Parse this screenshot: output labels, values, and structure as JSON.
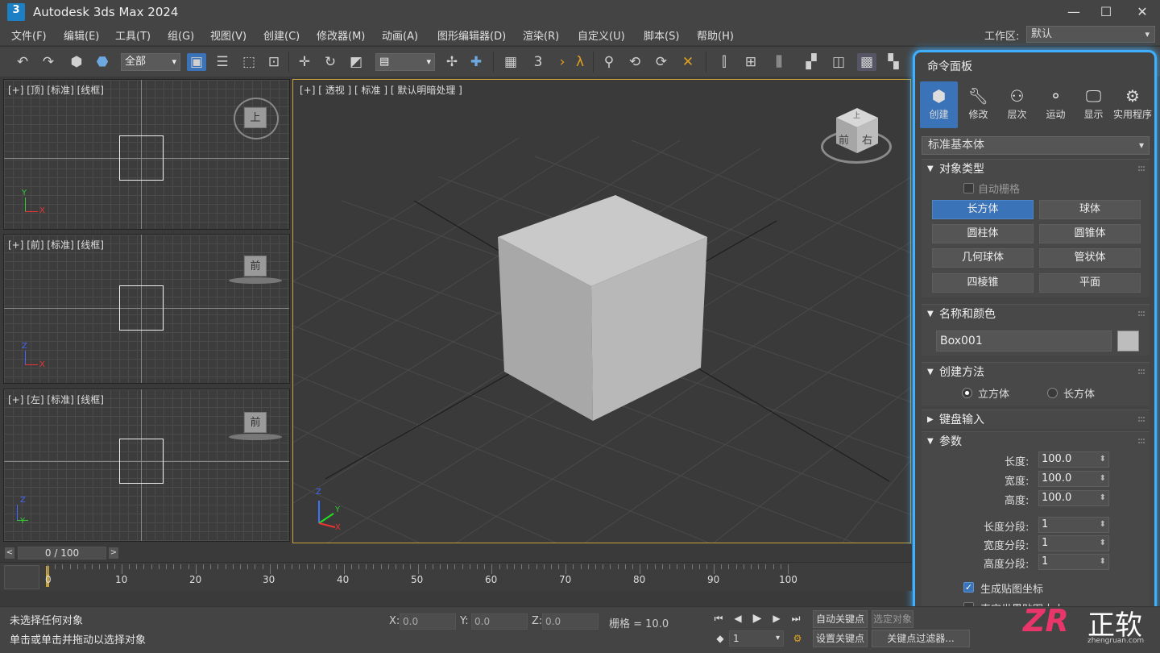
{
  "window": {
    "title": "Autodesk 3ds Max 2024",
    "app_icon": "3",
    "minimize": "—",
    "maximize": "☐",
    "close": "✕"
  },
  "menu": {
    "items": [
      "文件(F)",
      "编辑(E)",
      "工具(T)",
      "组(G)",
      "视图(V)",
      "创建(C)",
      "修改器(M)",
      "动画(A)",
      "图形编辑器(D)",
      "渲染(R)",
      "自定义(U)",
      "脚本(S)",
      "帮助(H)"
    ],
    "workspace_label": "工作区:",
    "workspace_value": "默认"
  },
  "toolbar": {
    "selection_filter": "全部",
    "icons": [
      "undo-icon",
      "redo-icon",
      "link-icon",
      "unlink-icon",
      "select-object-icon",
      "select-by-name-icon",
      "rect-select-icon",
      "window-crossing-icon",
      "move-icon",
      "rotate-icon",
      "scale-icon",
      "viewport-layout-icon",
      "pivot-icon",
      "snap-icon",
      "angle-snap-icon",
      "percent-snap-icon",
      "spinner-snap-icon",
      "named-selection-icon",
      "mirror-icon",
      "align-icon",
      "layer-icon",
      "scene-explorer-icon",
      "ribbon-icon",
      "curve-editor-icon",
      "schematic-icon",
      "material-editor-icon",
      "render-setup-icon",
      "render-frame-icon",
      "render-icon"
    ]
  },
  "viewports": {
    "top": {
      "label": "[+] [顶] [标准] [线框]",
      "cube_label": "上"
    },
    "front": {
      "label": "[+] [前] [标准] [线框]",
      "cube_label": "前"
    },
    "left": {
      "label": "[+] [左] [标准] [线框]",
      "cube_label": "前"
    },
    "perspective": {
      "label": "[+] [ 透视 ] [ 标准 ] [ 默认明暗处理 ]",
      "cube_top": "上",
      "cube_front": "前",
      "cube_right": "右"
    }
  },
  "axes": {
    "x": "X",
    "y": "Y",
    "z": "Z"
  },
  "command_panel": {
    "title": "命令面板",
    "tabs": [
      {
        "label": "创建",
        "icon": "create-icon"
      },
      {
        "label": "修改",
        "icon": "wrench-icon"
      },
      {
        "label": "层次",
        "icon": "hierarchy-icon"
      },
      {
        "label": "运动",
        "icon": "motion-icon"
      },
      {
        "label": "显示",
        "icon": "monitor-icon"
      },
      {
        "label": "实用程序",
        "icon": "gear-icon"
      }
    ],
    "category": "标准基本体",
    "object_type": {
      "title": "对象类型",
      "autogrid": "自动栅格",
      "buttons": [
        "长方体",
        "球体",
        "圆柱体",
        "圆锥体",
        "几何球体",
        "管状体",
        "四棱锥",
        "平面"
      ]
    },
    "name_color": {
      "title": "名称和颜色",
      "name": "Box001",
      "color": "#bdbdbd"
    },
    "creation_method": {
      "title": "创建方法",
      "options": [
        "立方体",
        "长方体"
      ]
    },
    "keyboard_entry": {
      "title": "键盘输入"
    },
    "parameters": {
      "title": "参数",
      "length_label": "长度:",
      "length": "100.0",
      "width_label": "宽度:",
      "width": "100.0",
      "height_label": "高度:",
      "height": "100.0",
      "length_segs_label": "长度分段:",
      "length_segs": "1",
      "width_segs_label": "宽度分段:",
      "width_segs": "1",
      "height_segs_label": "高度分段:",
      "height_segs": "1",
      "gen_mapping": "生成贴图坐标",
      "real_world": "真实世界贴图大小"
    }
  },
  "timeline": {
    "slider": "0 / 100",
    "start_marker": "0",
    "ticks": [
      "0",
      "10",
      "20",
      "30",
      "40",
      "50",
      "60",
      "70",
      "80",
      "90",
      "100"
    ]
  },
  "status": {
    "line1": "未选择任何对象",
    "line2": "单击或单击并拖动以选择对象",
    "x_label": "X:",
    "x": "0.0",
    "y_label": "Y:",
    "y": "0.0",
    "z_label": "Z:",
    "z": "0.0",
    "grid": "栅格 = 10.0",
    "frame": "1",
    "auto_key": "自动关键点",
    "selected": "选定对象",
    "set_key": "设置关键点",
    "key_filters": "关键点过滤器..."
  },
  "watermark": {
    "logo": "ZR",
    "text": "正软",
    "url": "zhengruan.com"
  },
  "colors": {
    "accent": "#3b73b8",
    "panel_glow": "#3fb0ff"
  }
}
